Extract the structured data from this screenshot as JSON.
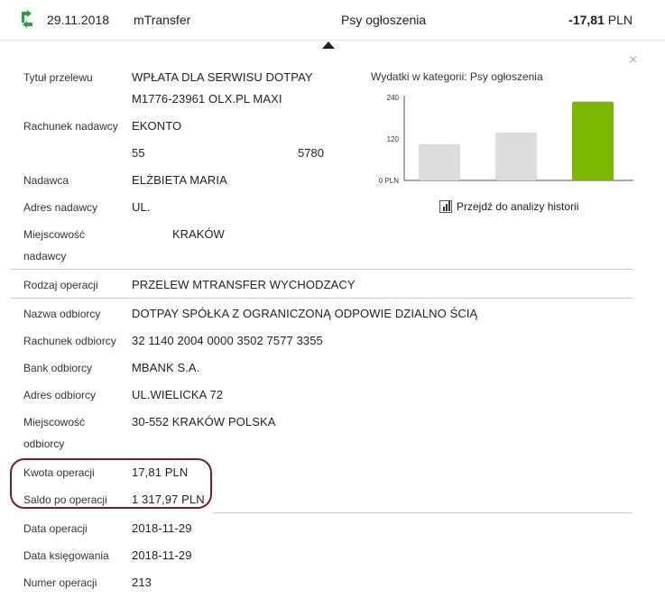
{
  "header": {
    "date": "29.11.2018",
    "type": "mTransfer",
    "category": "Psy ogłoszenia",
    "amount_value": "-17,81",
    "amount_currency": "PLN"
  },
  "close_symbol": "×",
  "details": {
    "title_label": "Tytuł przelewu",
    "title_line1": "WPŁATA DLA SERWISU DOTPAY",
    "title_line2": "M1776-23961 OLX.PL MAXI",
    "sender_account_label": "Rachunek nadawcy",
    "sender_account_line1": "EKONTO",
    "sender_account_part_a": "55",
    "sender_account_part_b": "5780",
    "sender_label": "Nadawca",
    "sender_value": "ELŻBIETA MARIA",
    "sender_address_label": "Adres nadawcy",
    "sender_address_value": "UL.",
    "sender_city_label_1": "Miejscowość",
    "sender_city_label_2": "nadawcy",
    "sender_city_value": "KRAKÓW",
    "operation_type_label": "Rodzaj operacji",
    "operation_type_value": "PRZELEW MTRANSFER WYCHODZACY",
    "recipient_name_label": "Nazwa odbiorcy",
    "recipient_name_value": "DOTPAY SPÓŁKA Z OGRANICZONĄ ODPOWIE DZIALNO ŚCIĄ",
    "recipient_account_label": "Rachunek odbiorcy",
    "recipient_account_value": "32 1140 2004 0000 3502 7577 3355",
    "recipient_bank_label": "Bank odbiorcy",
    "recipient_bank_value": "MBANK S.A.",
    "recipient_address_label": "Adres odbiorcy",
    "recipient_address_value": "UL.WIELICKA 72",
    "recipient_city_label_1": "Miejscowość",
    "recipient_city_label_2": "odbiorcy",
    "recipient_city_value": "30-552 KRAKÓW POLSKA",
    "amount_label": "Kwota operacji",
    "amount_value": "17,81 PLN",
    "balance_label": "Saldo po operacji",
    "balance_value": "1 317,97 PLN",
    "op_date_label": "Data operacji",
    "op_date_value": "2018-11-29",
    "book_date_label": "Data księgowania",
    "book_date_value": "2018-11-29",
    "op_number_label": "Numer operacji",
    "op_number_value": "213"
  },
  "chart_data": {
    "type": "bar",
    "title": "Wydatki w kategorii:  Psy ogłoszenia",
    "yticks": [
      "240",
      "120",
      "0 PLN"
    ],
    "ylim": [
      0,
      240
    ],
    "values": [
      105,
      138,
      228
    ],
    "colors": [
      "#dcdcdc",
      "#dcdcdc",
      "#7ab800"
    ],
    "grid": false
  },
  "history_link": "Przejdź do analizy historii",
  "colors": {
    "accent_green": "#7ab800",
    "highlight_border": "#7a1a2a"
  }
}
